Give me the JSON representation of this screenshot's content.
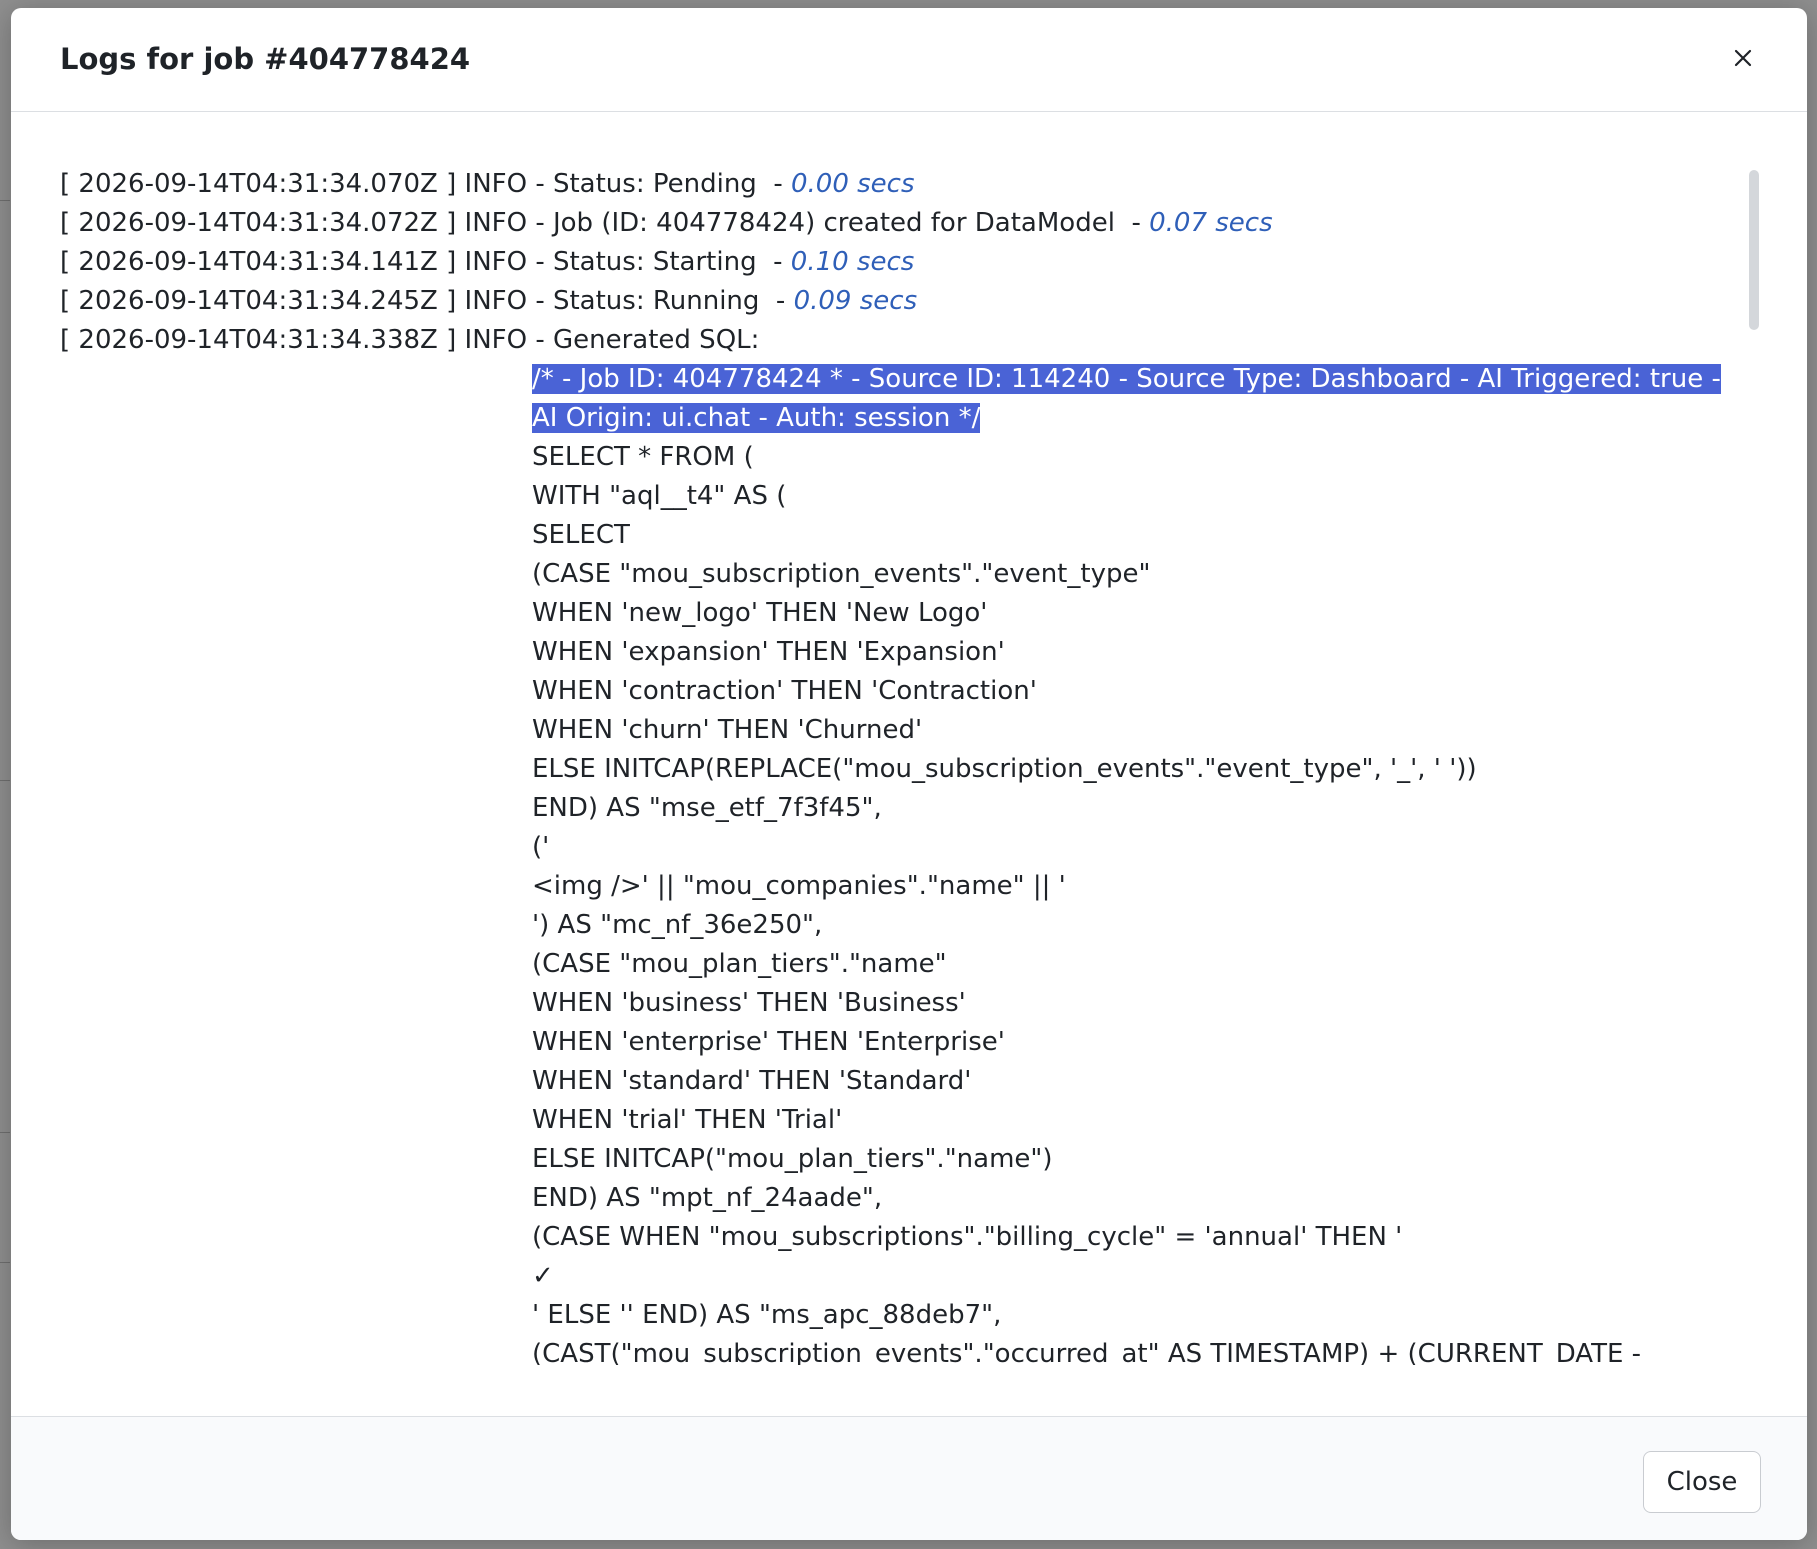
{
  "modal": {
    "title": "Logs for job #404778424",
    "close_icon": "close-icon",
    "footer_close_label": "Close"
  },
  "logs": [
    {
      "text": "[ 2026-09-14T04:31:34.070Z ] INFO - Status: Pending  - ",
      "duration": "0.00 secs"
    },
    {
      "text": "[ 2026-09-14T04:31:34.072Z ] INFO - Job (ID: 404778424) created for DataModel  - ",
      "duration": "0.07 secs"
    },
    {
      "text": "[ 2026-09-14T04:31:34.141Z ] INFO - Status: Starting  - ",
      "duration": "0.10 secs"
    },
    {
      "text": "[ 2026-09-14T04:31:34.245Z ] INFO - Status: Running  - ",
      "duration": "0.09 secs"
    },
    {
      "text": "[ 2026-09-14T04:31:34.338Z ] INFO - Generated SQL:",
      "duration": ""
    }
  ],
  "sql": {
    "highlighted": "/* - Job ID: 404778424 * - Source ID: 114240 - Source Type: Dashboard - AI Triggered: true - AI Origin: ui.chat - Auth: session */",
    "lines": [
      "SELECT * FROM (",
      "WITH \"aql__t4\" AS (",
      "SELECT",
      "(CASE \"mou_subscription_events\".\"event_type\"",
      "WHEN 'new_logo' THEN 'New Logo'",
      "WHEN 'expansion' THEN 'Expansion'",
      "WHEN 'contraction' THEN 'Contraction'",
      "WHEN 'churn' THEN 'Churned'",
      "ELSE INITCAP(REPLACE(\"mou_subscription_events\".\"event_type\", '_', ' '))",
      "END) AS \"mse_etf_7f3f45\",",
      "('",
      "<img />' || \"mou_companies\".\"name\" || '",
      "') AS \"mc_nf_36e250\",",
      "(CASE \"mou_plan_tiers\".\"name\"",
      "WHEN 'business' THEN 'Business'",
      "WHEN 'enterprise' THEN 'Enterprise'",
      "WHEN 'standard' THEN 'Standard'",
      "WHEN 'trial' THEN 'Trial'",
      "ELSE INITCAP(\"mou_plan_tiers\".\"name\")",
      "END) AS \"mpt_nf_24aade\",",
      "(CASE WHEN \"mou_subscriptions\".\"billing_cycle\" = 'annual' THEN '",
      "✓",
      "' ELSE '' END) AS \"ms_apc_88deb7\",",
      "(CAST(\"mou_subscription_events\".\"occurred_at\" AS TIMESTAMP) + (CURRENT_DATE -"
    ]
  }
}
